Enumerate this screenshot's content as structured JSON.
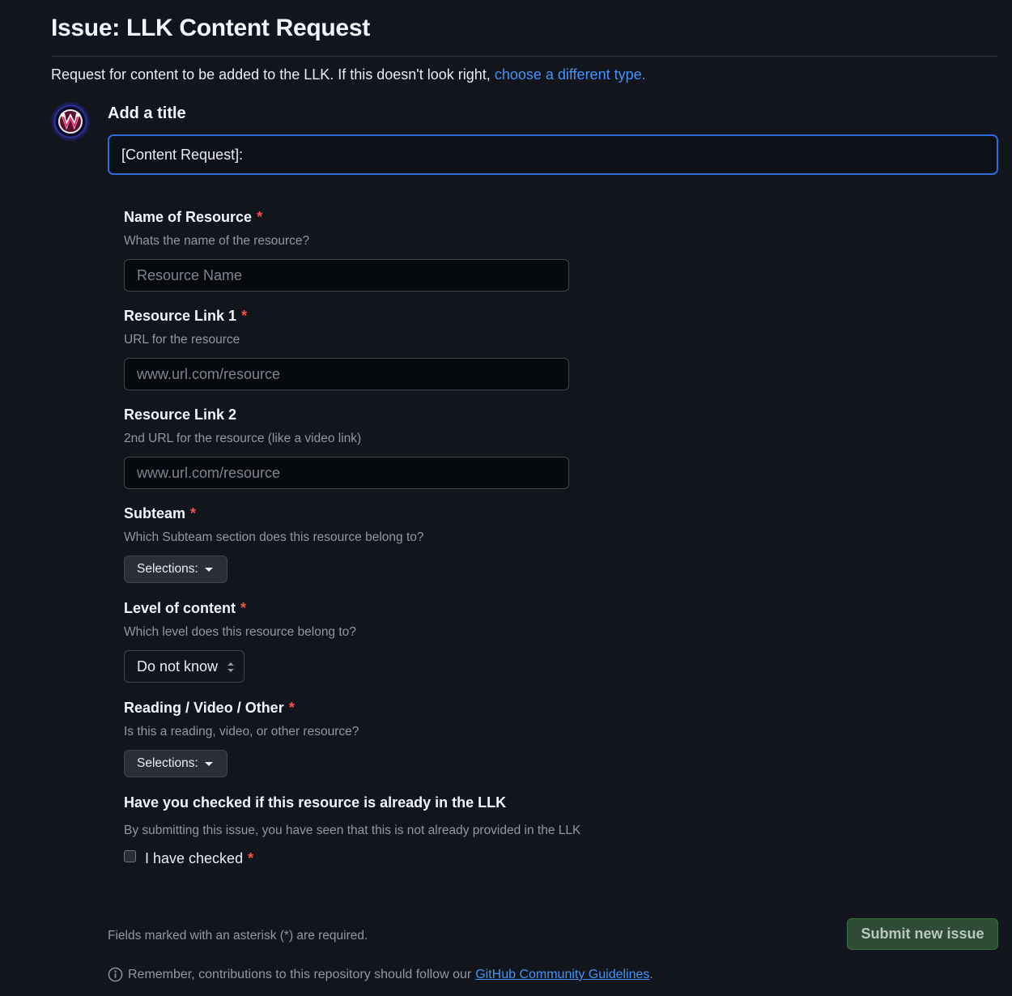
{
  "header": {
    "title": "Issue: LLK Content Request",
    "intro_text": "Request for content to be added to the LLK. If this doesn't look right,",
    "intro_link": "choose a different type."
  },
  "title_section": {
    "label": "Add a title",
    "value": "[Content Request]: "
  },
  "fields": {
    "name": {
      "label": "Name of Resource",
      "required": "*",
      "help": "Whats the name of the resource?",
      "placeholder": "Resource Name"
    },
    "link1": {
      "label": "Resource Link 1",
      "required": "*",
      "help": "URL for the resource",
      "placeholder": "www.url.com/resource"
    },
    "link2": {
      "label": "Resource Link 2",
      "help": "2nd URL for the resource (like a video link)",
      "placeholder": "www.url.com/resource"
    },
    "subteam": {
      "label": "Subteam",
      "required": "*",
      "help": "Which Subteam section does this resource belong to?",
      "button": "Selections:"
    },
    "level": {
      "label": "Level of content",
      "required": "*",
      "help": "Which level does this resource belong to?",
      "selected": "Do not know"
    },
    "type": {
      "label": "Reading / Video / Other",
      "required": "*",
      "help": "Is this a reading, video, or other resource?",
      "button": "Selections:"
    },
    "checked": {
      "label": "Have you checked if this resource is already in the LLK",
      "help": "By submitting this issue, you have seen that this is not already provided in the LLK",
      "checkbox_label": "I have checked",
      "required": "*",
      "checked": false
    }
  },
  "footer": {
    "required_note": "Fields marked with an asterisk (*) are required.",
    "submit_label": "Submit new issue",
    "guidelines_text": "Remember, contributions to this repository should follow our",
    "guidelines_link": "GitHub Community Guidelines",
    "guidelines_end": "."
  },
  "colors": {
    "background": "#12151c",
    "link": "#4493f8",
    "required": "#f85149",
    "submit_bg": "#2e4c33",
    "focus_border": "#2f6bda"
  },
  "icons": {
    "avatar": "team-logo-avatar",
    "info": "info-icon",
    "caret": "caret-down-icon",
    "select": "select-updown-icon"
  }
}
